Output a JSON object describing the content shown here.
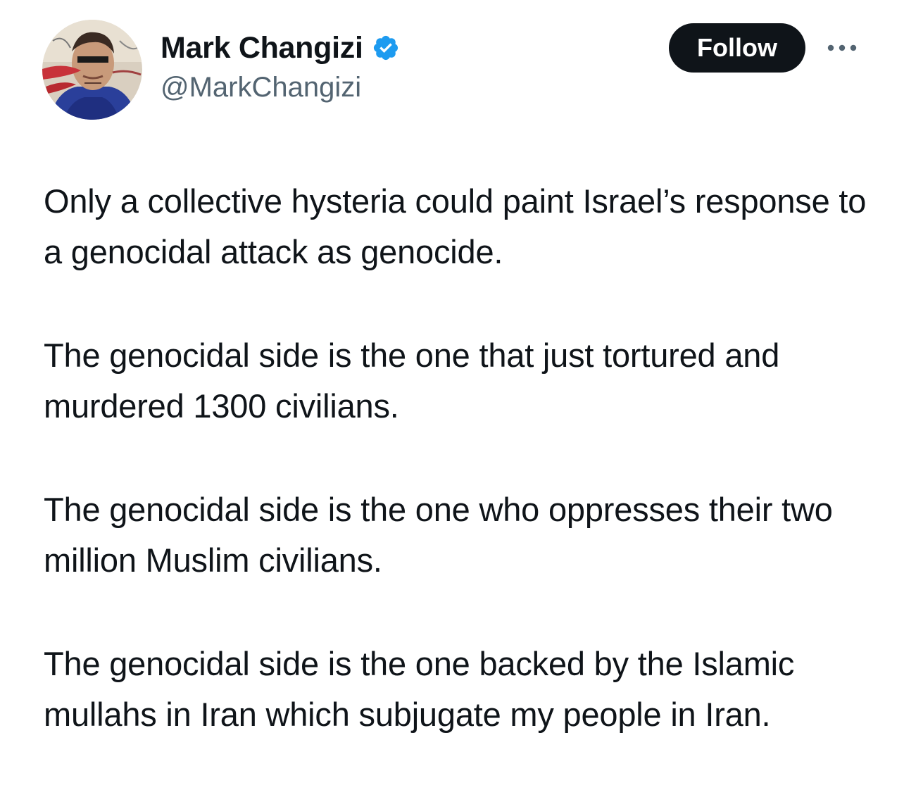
{
  "author": {
    "display_name": "Mark Changizi",
    "handle": "@MarkChangizi",
    "verified": true,
    "verified_color": "#1d9bf0"
  },
  "actions": {
    "follow_label": "Follow",
    "more_icon": "more-horizontal-icon"
  },
  "tweet": {
    "paragraphs": [
      "Only a collective hysteria could paint Israel’s response to a genocidal attack as genocide.",
      "The genocidal side is the one that just tortured and murdered 1300 civilians.",
      "The genocidal side is the one who oppresses their two million Muslim civilians.",
      "The genocidal side is the one backed by the Islamic mullahs in Iran which subjugate my people in Iran."
    ]
  },
  "colors": {
    "text": "#0f1419",
    "secondary_text": "#536471",
    "button_bg": "#0f1419",
    "button_text": "#ffffff"
  }
}
